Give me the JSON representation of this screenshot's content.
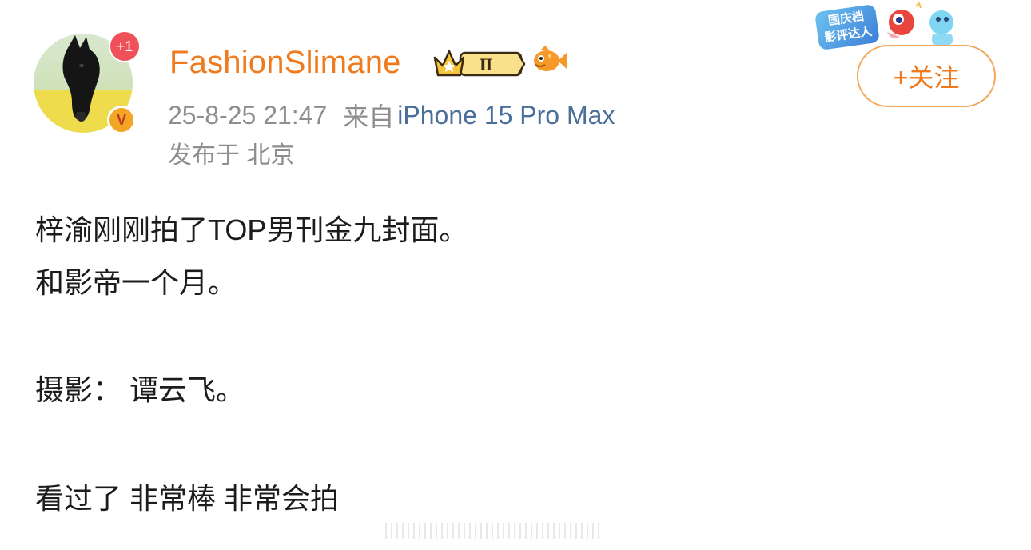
{
  "user": {
    "name": "FashionSlimane",
    "notification_badge": "+1",
    "verified_badge": "V",
    "vip_level": "Ⅱ"
  },
  "post": {
    "timestamp": "25-8-25 21:47",
    "source_label": "来自",
    "device": "iPhone 15 Pro Max",
    "location": "发布于 北京",
    "lines": [
      "梓渝刚刚拍了TOP男刊金九封面。",
      "和影帝一个月。",
      "摄影：  谭云飞。",
      "看过了 非常棒  非常会拍"
    ]
  },
  "actions": {
    "follow_label": "+关注"
  },
  "event_badge": {
    "text_line1": "国庆档",
    "text_line2": "影评达人"
  },
  "colors": {
    "username": "#f07a1e",
    "follow_border": "#f3a65c",
    "meta_text": "#8e8e8e",
    "device_link": "#4a6f9a",
    "body_text": "#1c1c1c"
  },
  "icons": [
    "crown-icon",
    "fish-icon",
    "mascot-icon"
  ]
}
